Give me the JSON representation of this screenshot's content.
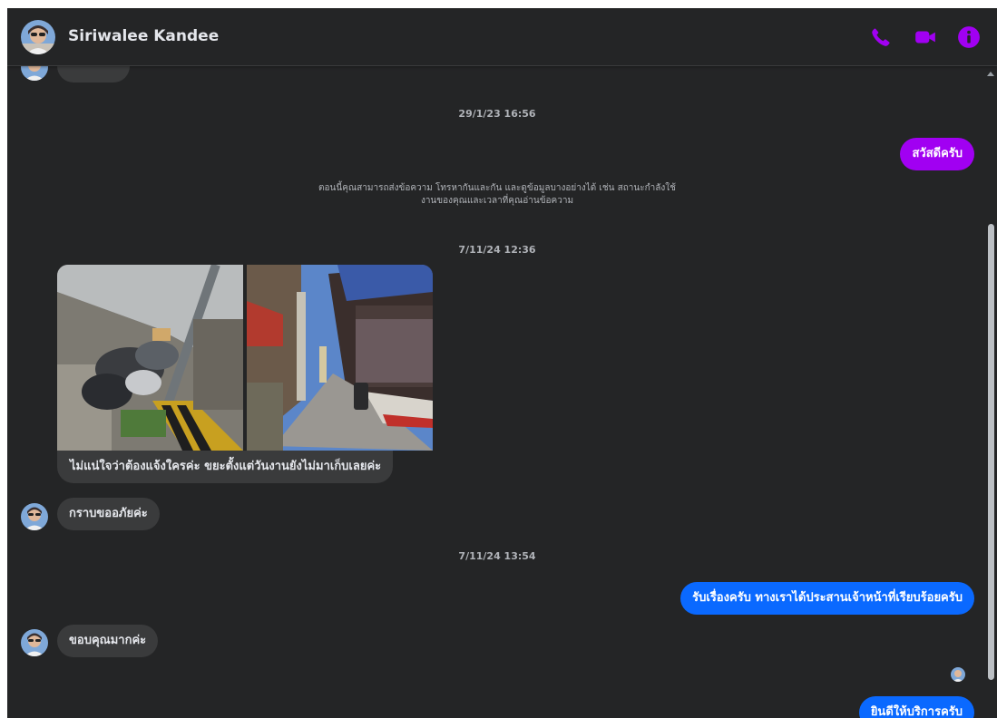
{
  "header": {
    "contact_name": "Siriwalee Kandee",
    "icons": [
      "phone-icon",
      "video-camera-icon",
      "info-icon"
    ],
    "accent_color": "#a100f2"
  },
  "thread": {
    "timestamp_1": "29/1/23 16:56",
    "msg_out_1": "สวัสดีครับ",
    "system_note_line1": "ตอนนี้คุณสามารถส่งข้อความ โทรหากันและกัน และดูข้อมูลบางอย่างได้ เช่น สถานะกำลังใช้",
    "system_note_line2": "งานของคุณและเวลาที่คุณอ่านข้อความ",
    "timestamp_2": "7/11/24 12:36",
    "msg_in_1": "ไม่แน่ใจว่าต้องแจ้งใครค่ะ ขยะตั้งแต่วันงานยังไม่มาเก็บเลยค่ะ",
    "msg_in_2": "กราบขออภัยค่ะ",
    "timestamp_3": "7/11/24 13:54",
    "msg_out_2": "รับเรื่องครับ ทางเราได้ประสานเจ้าหน้าที่เรียบร้อยครับ",
    "msg_in_3": "ขอบคุณมากค่ะ",
    "msg_out_3": "ยินดีให้บริการครับ"
  },
  "colors": {
    "background": "#242526",
    "incoming_bubble": "#3a3b3c",
    "outgoing_purple": "#a100f2",
    "outgoing_blue": "#0a69ff"
  }
}
